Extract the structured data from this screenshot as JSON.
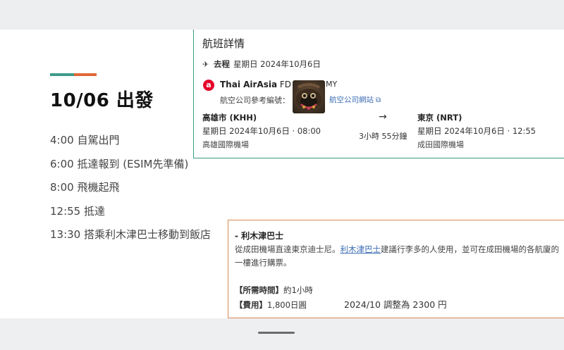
{
  "day": {
    "title": "10/06 出發"
  },
  "timeline": [
    "4:00 自駕出門",
    "6:00 抵達報到 (ESIM先準備)",
    "8:00  飛機起飛",
    "12:55 抵達",
    "13:30 搭乘利木津巴士移動到飯店"
  ],
  "flight": {
    "title": "航班詳情",
    "leg_icon": "plane-departure-icon",
    "leg_label": "去程",
    "leg_date": "星期日 2024年10月6日",
    "airline_logo_char": "a",
    "airline_name": "Thai AirAsia",
    "flight_no": "FD 23",
    "airline_suffix": "MY",
    "ref_label": "航空公司參考編號：",
    "airline_link": "航空公司網站",
    "departure": {
      "city": "高雄市 (KHH)",
      "datetime": "星期日 2024年10月6日 · 08:00",
      "airport": "高雄國際機場"
    },
    "arrival": {
      "city": "東京 (NRT)",
      "datetime": "星期日 2024年10月6日 · 12:55",
      "airport": "成田國際機場"
    },
    "duration": "3小時 55分鐘",
    "arrow": "→"
  },
  "bus": {
    "title": "- 利木津巴士",
    "desc_before": "從成田機場直達東京迪士尼。",
    "desc_link": "利木津巴士",
    "desc_after": "建議行李多的人使用，並可在成田機場的各航廈的一樓進行購票。",
    "time_label": "【所需時間】",
    "time_value": "約1小時",
    "fee_label": "【費用】",
    "fee_value": "1,800日圓",
    "note": "2024/10 調整為 2300 円"
  },
  "colors": {
    "teal": "#3e9c8a",
    "orange": "#e0673a",
    "link": "#3f6fb5",
    "airasia_red": "#e5002b"
  }
}
